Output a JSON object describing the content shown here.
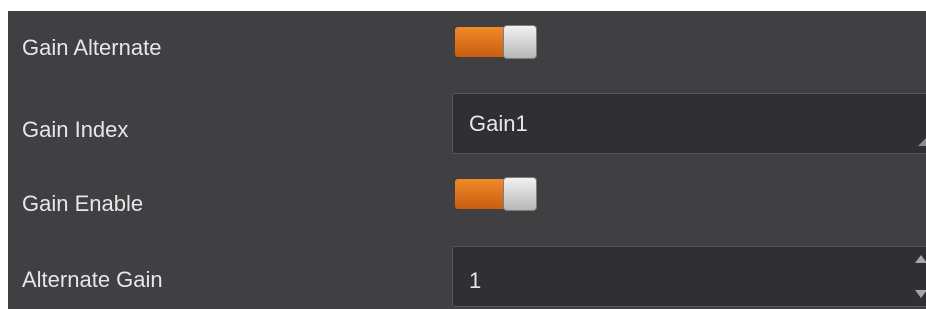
{
  "rows": [
    {
      "label": "Gain Alternate",
      "control": "toggle",
      "state": "on"
    },
    {
      "label": "Gain Index",
      "control": "dropdown",
      "value": "Gain1"
    },
    {
      "label": "Gain Enable",
      "control": "toggle",
      "state": "on"
    },
    {
      "label": "Alternate Gain",
      "control": "spinbox",
      "value": "1"
    }
  ],
  "colors": {
    "panel_background": "#404043",
    "field_background": "#303033",
    "toggle_on": "#e07a1f",
    "text": "#e6e6e6"
  },
  "icons": {
    "dropdown_grip": "resize-grip-icon",
    "spin_up": "up-triangle-icon",
    "spin_down": "down-triangle-icon"
  }
}
